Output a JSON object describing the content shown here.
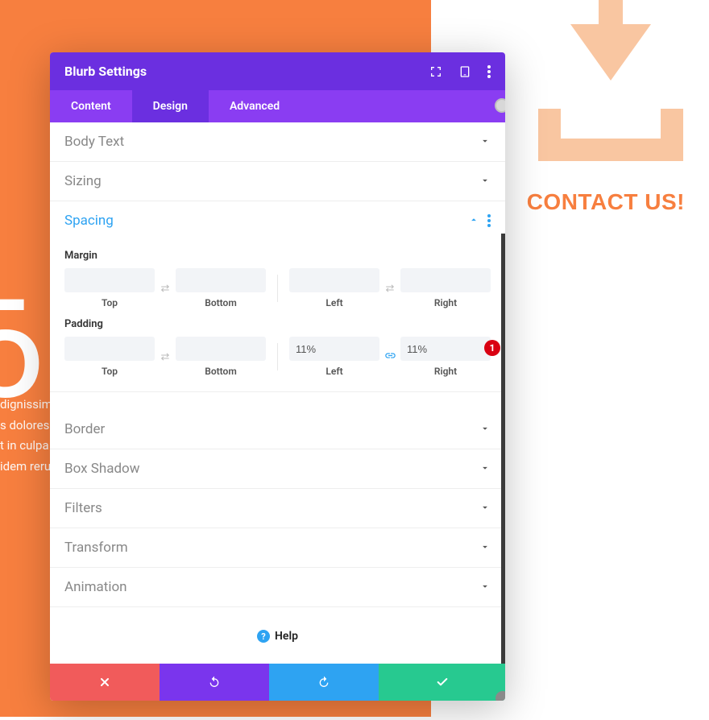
{
  "background": {
    "letters_line1": "L",
    "letters_line2": "O",
    "text_line1": "dignissim",
    "text_line2": "s dolores",
    "text_line3": "t in culpa",
    "text_line4": "idem reru",
    "contact_us": "CONTACT US!"
  },
  "modal": {
    "title": "Blurb Settings",
    "tabs": {
      "content": "Content",
      "design": "Design",
      "advanced": "Advanced"
    },
    "sections": {
      "body_text": "Body Text",
      "sizing": "Sizing",
      "spacing": "Spacing",
      "border": "Border",
      "box_shadow": "Box Shadow",
      "filters": "Filters",
      "transform": "Transform",
      "animation": "Animation"
    },
    "spacing": {
      "margin_label": "Margin",
      "padding_label": "Padding",
      "top": "Top",
      "bottom": "Bottom",
      "left": "Left",
      "right": "Right",
      "margin_top": "",
      "margin_bottom": "",
      "margin_left": "",
      "margin_right": "",
      "padding_top": "",
      "padding_bottom": "",
      "padding_left": "11%",
      "padding_right": "11%"
    },
    "badge": "1",
    "help": "Help"
  }
}
